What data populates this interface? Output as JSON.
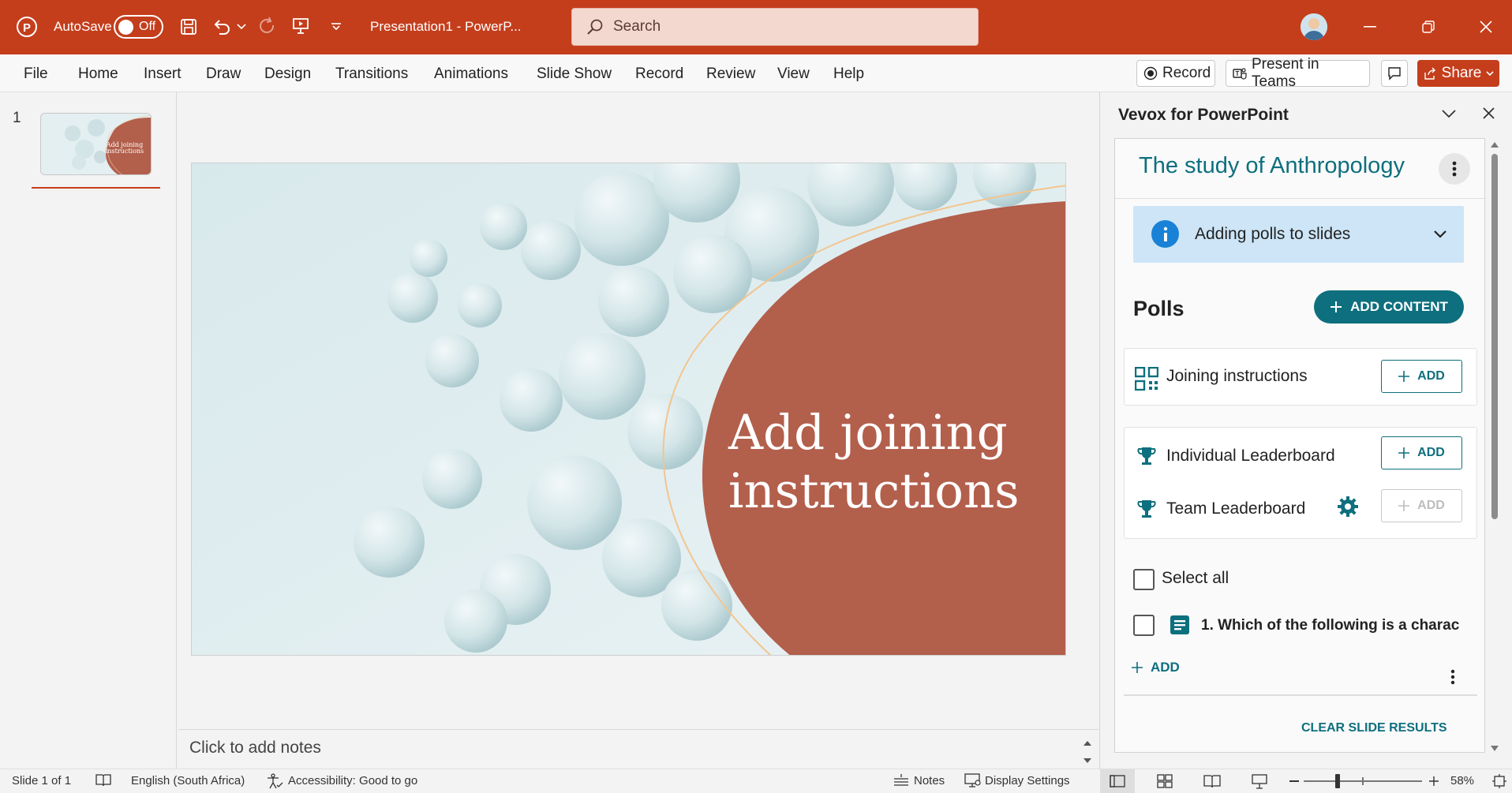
{
  "titlebar": {
    "autosave_label": "AutoSave",
    "autosave_state": "Off",
    "doc_title": "Presentation1  -  PowerP...",
    "search_placeholder": "Search"
  },
  "ribbon": {
    "tabs": [
      "File",
      "Home",
      "Insert",
      "Draw",
      "Design",
      "Transitions",
      "Animations",
      "Slide Show",
      "Record",
      "Review",
      "View",
      "Help"
    ],
    "record_label": "Record",
    "present_teams_label": "Present in Teams",
    "share_label": "Share"
  },
  "thumbnails": {
    "slide_number": "1",
    "thumb_text": "Add joining instructions"
  },
  "slide": {
    "title_line1": "Add joining",
    "title_line2": "instructions"
  },
  "notes": {
    "placeholder": "Click to add notes"
  },
  "taskpane": {
    "title": "Vevox for PowerPoint",
    "session_title": "The study of Anthropology",
    "info_banner": "Adding polls to slides",
    "polls_heading": "Polls",
    "add_content_label": "ADD CONTENT",
    "joining_label": "Joining instructions",
    "add_label": "ADD",
    "individual_leaderboard": "Individual Leaderboard",
    "team_leaderboard": "Team Leaderboard",
    "select_all": "Select all",
    "poll_item": "1. Which of the following is a charac",
    "add_link": "ADD",
    "clear_results": "CLEAR SLIDE RESULTS"
  },
  "statusbar": {
    "slide_counter": "Slide 1 of 1",
    "language": "English (South Africa)",
    "accessibility": "Accessibility: Good to go",
    "notes": "Notes",
    "display_settings": "Display Settings",
    "zoom": "58%"
  },
  "colors": {
    "brand": "#c43e1c",
    "vevox_teal": "#0e6f7e",
    "slide_shape": "#b25f4c"
  }
}
